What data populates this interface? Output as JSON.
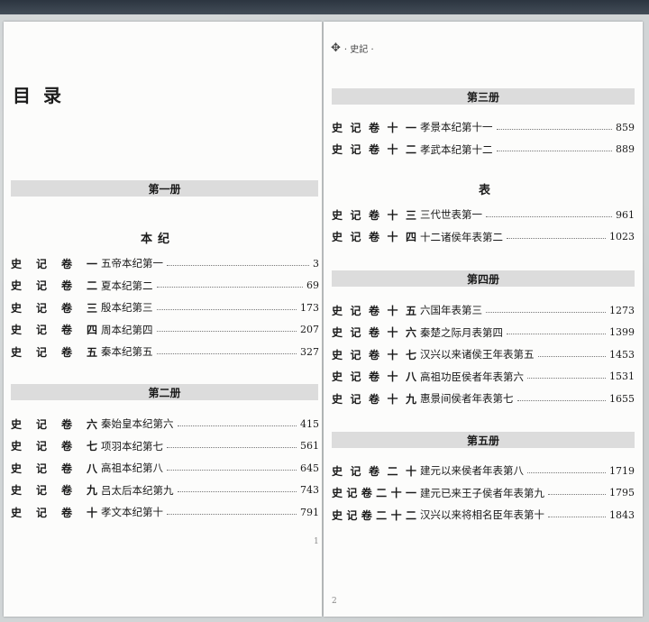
{
  "left_page": {
    "title": "目录",
    "page_number": "1",
    "volumes": [
      {
        "label": "第一册",
        "section": "本纪",
        "entries": [
          {
            "juan": [
              "史",
              "记",
              "卷",
              "一"
            ],
            "title": "五帝本纪第一",
            "page": "3"
          },
          {
            "juan": [
              "史",
              "记",
              "卷",
              "二"
            ],
            "title": "夏本纪第二",
            "page": "69"
          },
          {
            "juan": [
              "史",
              "记",
              "卷",
              "三"
            ],
            "title": "殷本纪第三",
            "page": "173"
          },
          {
            "juan": [
              "史",
              "记",
              "卷",
              "四"
            ],
            "title": "周本纪第四",
            "page": "207"
          },
          {
            "juan": [
              "史",
              "记",
              "卷",
              "五"
            ],
            "title": "秦本纪第五",
            "page": "327"
          }
        ]
      },
      {
        "label": "第二册",
        "entries": [
          {
            "juan": [
              "史",
              "记",
              "卷",
              "六"
            ],
            "title": "秦始皇本纪第六",
            "page": "415"
          },
          {
            "juan": [
              "史",
              "记",
              "卷",
              "七"
            ],
            "title": "项羽本纪第七",
            "page": "561"
          },
          {
            "juan": [
              "史",
              "记",
              "卷",
              "八"
            ],
            "title": "高祖本纪第八",
            "page": "645"
          },
          {
            "juan": [
              "史",
              "记",
              "卷",
              "九"
            ],
            "title": "吕太后本纪第九",
            "page": "743"
          },
          {
            "juan": [
              "史",
              "记",
              "卷",
              "十"
            ],
            "title": "孝文本纪第十",
            "page": "791"
          }
        ]
      }
    ]
  },
  "right_page": {
    "header_glyph": "✥",
    "header_text": "· 史記 ·",
    "page_number": "2",
    "volumes": [
      {
        "label": "第三册",
        "entries": [
          {
            "juan": [
              "史",
              "记",
              "卷",
              "十",
              "一"
            ],
            "title": "孝景本纪第十一",
            "page": "859"
          },
          {
            "juan": [
              "史",
              "记",
              "卷",
              "十",
              "二"
            ],
            "title": "孝武本纪第十二",
            "page": "889"
          }
        ],
        "section": "表",
        "entries2": [
          {
            "juan": [
              "史",
              "记",
              "卷",
              "十",
              "三"
            ],
            "title": "三代世表第一",
            "page": "961"
          },
          {
            "juan": [
              "史",
              "记",
              "卷",
              "十",
              "四"
            ],
            "title": "十二诸侯年表第二",
            "page": "1023"
          }
        ]
      },
      {
        "label": "第四册",
        "entries": [
          {
            "juan": [
              "史",
              "记",
              "卷",
              "十",
              "五"
            ],
            "title": "六国年表第三",
            "page": "1273"
          },
          {
            "juan": [
              "史",
              "记",
              "卷",
              "十",
              "六"
            ],
            "title": "秦楚之际月表第四",
            "page": "1399"
          },
          {
            "juan": [
              "史",
              "记",
              "卷",
              "十",
              "七"
            ],
            "title": "汉兴以来诸侯王年表第五",
            "page": "1453"
          },
          {
            "juan": [
              "史",
              "记",
              "卷",
              "十",
              "八"
            ],
            "title": "高祖功臣侯者年表第六",
            "page": "1531"
          },
          {
            "juan": [
              "史",
              "记",
              "卷",
              "十",
              "九"
            ],
            "title": "惠景间侯者年表第七",
            "page": "1655"
          }
        ]
      },
      {
        "label": "第五册",
        "entries": [
          {
            "juan": [
              "史",
              "记",
              "卷",
              "二",
              "十"
            ],
            "title": "建元以来侯者年表第八",
            "page": "1719"
          },
          {
            "juan": [
              "史",
              "记",
              "卷",
              "二",
              "十",
              "一"
            ],
            "title": "建元已来王子侯者年表第九",
            "page": "1795"
          },
          {
            "juan": [
              "史",
              "记",
              "卷",
              "二",
              "十",
              "二"
            ],
            "title": "汉兴以来将相名臣年表第十",
            "page": "1843"
          }
        ]
      }
    ]
  }
}
